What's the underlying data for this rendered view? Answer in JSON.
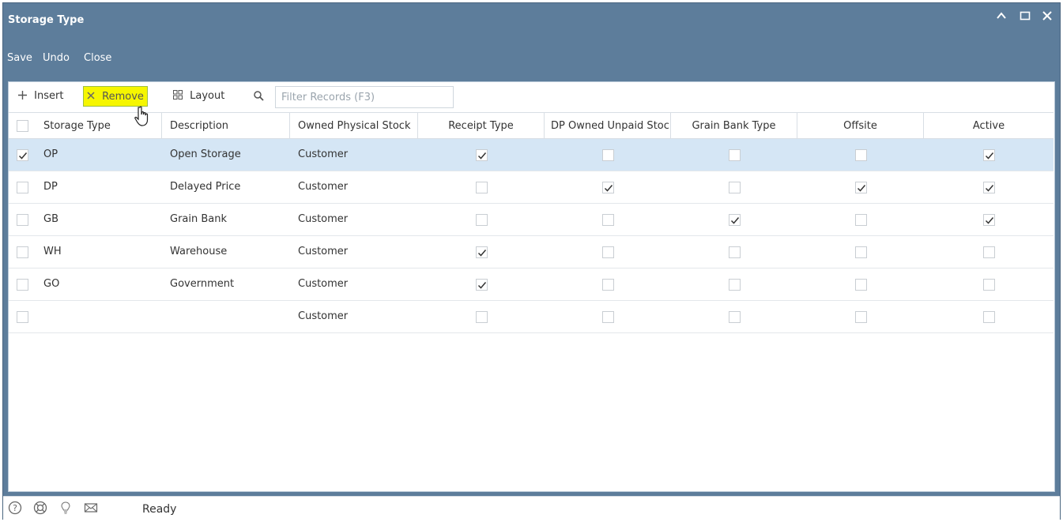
{
  "window": {
    "title": "Storage Type"
  },
  "menu": {
    "save": "Save",
    "undo": "Undo",
    "close": "Close"
  },
  "toolbar": {
    "insert": "Insert",
    "remove": "Remove",
    "layout": "Layout",
    "filter_placeholder": "Filter Records (F3)"
  },
  "columns": {
    "storage_type": "Storage Type",
    "description": "Description",
    "owned_physical_stock": "Owned Physical Stock",
    "receipt_type": "Receipt Type",
    "dp_owned_unpaid": "DP Owned Unpaid Stock",
    "grain_bank_type": "Grain Bank Type",
    "offsite": "Offsite",
    "active": "Active"
  },
  "rows": [
    {
      "selected": true,
      "code": "OP",
      "description": "Open Storage",
      "owned": "Customer",
      "receipt": true,
      "dp": false,
      "grain": false,
      "offsite": false,
      "active": true
    },
    {
      "selected": false,
      "code": "DP",
      "description": "Delayed Price",
      "owned": "Customer",
      "receipt": false,
      "dp": true,
      "grain": false,
      "offsite": true,
      "active": true
    },
    {
      "selected": false,
      "code": "GB",
      "description": "Grain Bank",
      "owned": "Customer",
      "receipt": false,
      "dp": false,
      "grain": true,
      "offsite": false,
      "active": true
    },
    {
      "selected": false,
      "code": "WH",
      "description": "Warehouse",
      "owned": "Customer",
      "receipt": true,
      "dp": false,
      "grain": false,
      "offsite": false,
      "active": false
    },
    {
      "selected": false,
      "code": "GO",
      "description": "Government",
      "owned": "Customer",
      "receipt": true,
      "dp": false,
      "grain": false,
      "offsite": false,
      "active": false
    },
    {
      "selected": false,
      "code": "",
      "description": "",
      "owned": "Customer",
      "receipt": false,
      "dp": false,
      "grain": false,
      "offsite": false,
      "active": false
    }
  ],
  "status": {
    "text": "Ready"
  },
  "icons": {
    "help": "help-icon",
    "support": "lifebuoy-icon",
    "idea": "lightbulb-icon",
    "mail": "mail-icon",
    "insert": "plus-icon",
    "remove": "x-icon",
    "layout": "grid-icon",
    "search": "search-icon"
  },
  "colors": {
    "titlebar": "#5d7d9b",
    "selected_row": "#d5e6f5",
    "remove_highlight": "#f6f600"
  }
}
